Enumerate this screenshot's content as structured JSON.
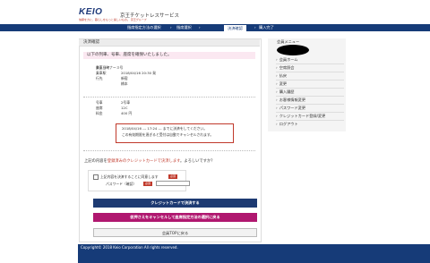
{
  "header": {
    "logo": "KEIO",
    "tagline": "信頼を力に、暮らしをもっと楽しいもの。 京王グループ",
    "service": "京王チケットレスサービス"
  },
  "steps": [
    {
      "label": "指席指定方法の選択"
    },
    {
      "label": "指席選択"
    },
    {
      "label": "決済確認",
      "active": true
    },
    {
      "label": "購入完了"
    }
  ],
  "panel": {
    "title": "決済確認",
    "notice": "以下の列車、号車、座席を確保いたしました。",
    "train_rows": [
      {
        "label": "",
        "value": "京王ライナー３号"
      },
      {
        "label": "乗車日時",
        "value": "2018/04/16 20:30 発"
      },
      {
        "label": "乗車駅",
        "value": "新宿"
      },
      {
        "label": "行先",
        "value": "橋本"
      }
    ],
    "seat_rows": [
      {
        "label": "号車",
        "value": "2号車"
      },
      {
        "label": "座席",
        "value": "12C"
      },
      {
        "label": "料金",
        "value": "400 円"
      }
    ],
    "deadline_line1": "2018/04/16 --- 17:24 --- までに決済をしてください。",
    "deadline_line2": "この有効期限を過ぎると受付は自動でキャンセルされます。",
    "confirm_prefix": "上記の内容を",
    "confirm_emph": "登録済みのクレジットカードで決済します",
    "confirm_suffix": "。よろしいですか？",
    "agree_label": "上記内容を決済することに同意します",
    "required_badge": "必須",
    "password_label": "パスワード（確認）"
  },
  "buttons": {
    "pay": "クレジットカードで決済する",
    "cancel": "仮押さえをキャンセルして座席指定方法の選択に戻る",
    "top": "会員TOPに戻る"
  },
  "sidebar": {
    "title": "会員メニュー",
    "items": [
      "会員ホーム",
      "空席照会",
      "払戻",
      "変更",
      "購入履歴",
      "お客様情報変更",
      "パスワード変更",
      "クレジットカード登録/変更",
      "ログアウト"
    ]
  },
  "footer": "Copyright© 2018 Keio Corporation All rights reserved."
}
